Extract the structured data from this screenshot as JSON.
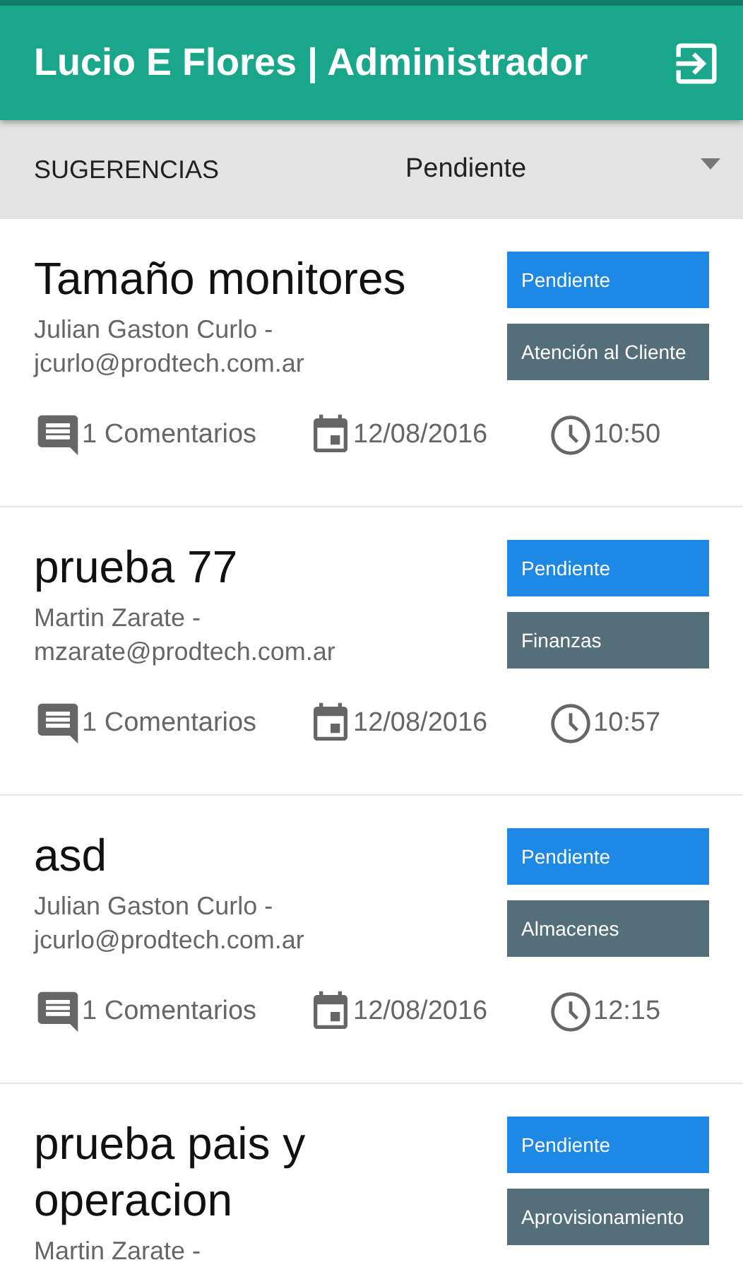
{
  "app_bar": {
    "title": "Lucio E Flores | Administrador"
  },
  "filter_bar": {
    "section": "SUGERENCIAS",
    "status_filter": "Pendiente"
  },
  "suggestions": [
    {
      "title": "Tamaño monitores",
      "author": "Julian Gaston Curlo -",
      "email": "jcurlo@prodtech.com.ar",
      "status": "Pendiente",
      "category": "Atención al Cliente",
      "comments": "1 Comentarios",
      "date": "12/08/2016",
      "time": "10:50"
    },
    {
      "title": "prueba 77",
      "author": "Martin Zarate -",
      "email": "mzarate@prodtech.com.ar",
      "status": "Pendiente",
      "category": "Finanzas",
      "comments": "1 Comentarios",
      "date": "12/08/2016",
      "time": "10:57"
    },
    {
      "title": "asd",
      "author": "Julian Gaston Curlo -",
      "email": "jcurlo@prodtech.com.ar",
      "status": "Pendiente",
      "category": "Almacenes",
      "comments": "1 Comentarios",
      "date": "12/08/2016",
      "time": "12:15"
    },
    {
      "title": "prueba pais y operacion",
      "author": "Martin Zarate -",
      "status": "Pendiente",
      "category": "Aprovisionamiento"
    }
  ]
}
